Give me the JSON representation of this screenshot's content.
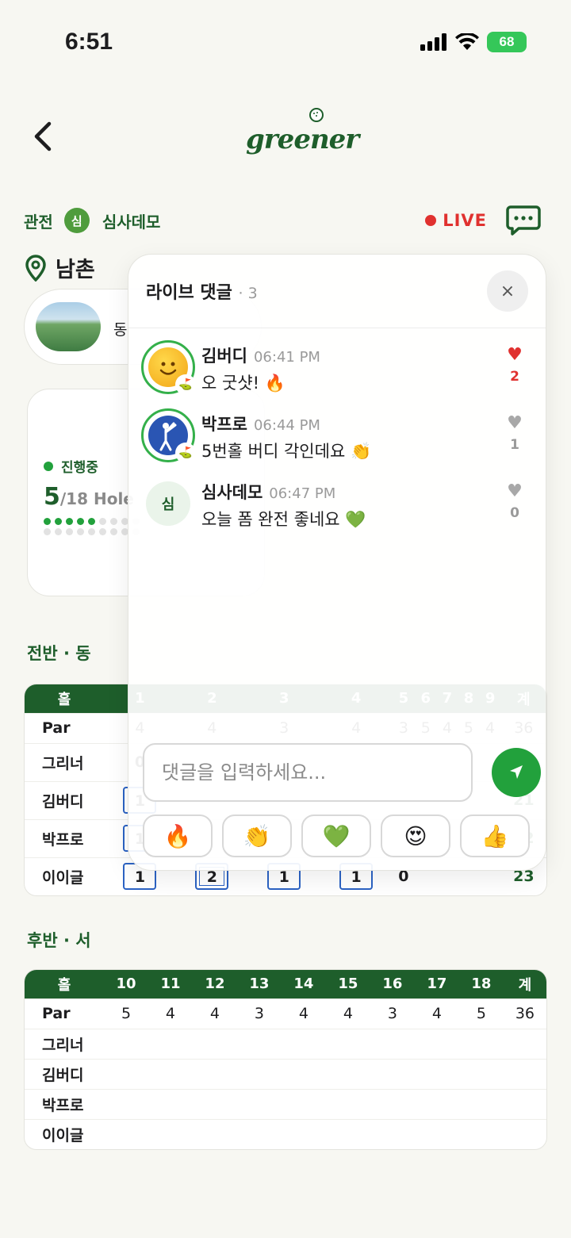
{
  "status_bar": {
    "time": "6:51",
    "battery": "68"
  },
  "header": {
    "logo_text": "greener"
  },
  "watch": {
    "label": "관전",
    "avatar_initial": "심",
    "player_name": "심사데모",
    "live_label": "LIVE"
  },
  "course": {
    "name": "남촌",
    "card_label": "동"
  },
  "progress": {
    "status": "진행중",
    "hole_current": "5",
    "hole_total": "/18 Hole",
    "completed_holes": 5,
    "total_holes": 18
  },
  "front_nine": {
    "title": "전반 · 동",
    "header": [
      "홀",
      "1",
      "2",
      "3",
      "4",
      "5",
      "6",
      "7",
      "8",
      "9",
      "계"
    ],
    "par": [
      "Par",
      "4",
      "4",
      "3",
      "4",
      "3",
      "5",
      "4",
      "5",
      "4",
      "36"
    ],
    "rows": [
      {
        "name": "그리너",
        "scores": [
          "0"
        ],
        "total": ""
      },
      {
        "name": "김버디",
        "scores": [
          "1"
        ],
        "total": "21"
      },
      {
        "name": "박프로",
        "scores": [
          "1"
        ],
        "total": "22"
      },
      {
        "name": "이이글",
        "scores": [
          "1",
          "2",
          "1",
          "1",
          "0"
        ],
        "total": "23"
      }
    ]
  },
  "back_nine": {
    "title": "후반 · 서",
    "header": [
      "홀",
      "10",
      "11",
      "12",
      "13",
      "14",
      "15",
      "16",
      "17",
      "18",
      "계"
    ],
    "par": [
      "Par",
      "5",
      "4",
      "4",
      "3",
      "4",
      "4",
      "3",
      "4",
      "5",
      "36"
    ],
    "players": [
      "그리너",
      "김버디",
      "박프로",
      "이이글"
    ]
  },
  "live_comments": {
    "title": "라이브 댓글",
    "count": "· 3",
    "close_label": "×",
    "comments": [
      {
        "author": "김버디",
        "time": "06:41 PM",
        "text": "오 굿샷! 🔥",
        "likes": "2",
        "liked": true,
        "avatar": "smile"
      },
      {
        "author": "박프로",
        "time": "06:44 PM",
        "text": "5번홀 버디 각인데요 👏",
        "likes": "1",
        "liked": false,
        "avatar": "golfer"
      },
      {
        "author": "심사데모",
        "time": "06:47 PM",
        "text": "오늘 폼 완전 좋네요 💚",
        "likes": "0",
        "liked": false,
        "avatar": "심"
      }
    ],
    "input_placeholder": "댓글을 입력하세요...",
    "reactions": [
      "🔥",
      "👏",
      "💚",
      "😍",
      "👍"
    ]
  },
  "colors": {
    "brand_green": "#1e5e2b",
    "accent_green": "#22a13c",
    "live_red": "#e0312f",
    "score_blue": "#2c63c4"
  }
}
